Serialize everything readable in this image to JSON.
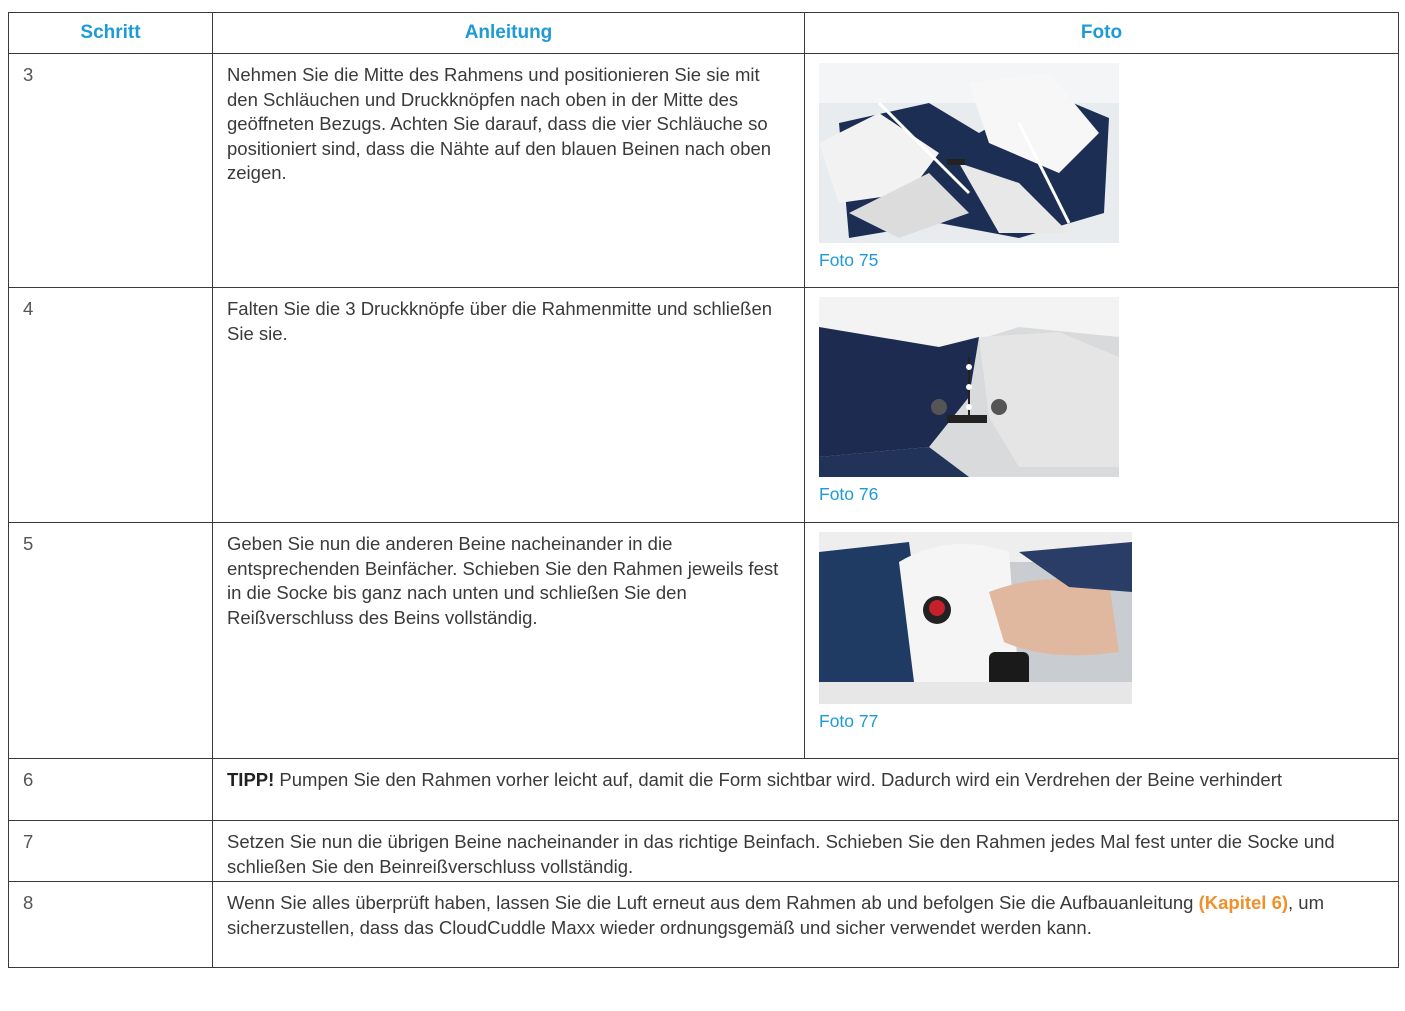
{
  "header": {
    "col1": "Schritt",
    "col2": "Anleitung",
    "col3": "Foto"
  },
  "rows": [
    {
      "step": "3",
      "text": "Nehmen Sie die Mitte des Rahmens und positionieren Sie sie mit den Schläuchen und Druckknöpfen nach oben in der Mitte des geöffneten Bezugs. Achten Sie darauf, dass die vier Schläuche so positioniert sind, dass die Nähte auf den blauen Beinen nach oben zeigen.",
      "caption": "Foto 75"
    },
    {
      "step": "4",
      "text": "Falten Sie die 3 Druckknöpfe über die Rahmenmitte und schließen Sie sie.",
      "caption": "Foto 76"
    },
    {
      "step": "5",
      "text": "Geben Sie nun die anderen Beine nacheinander in die entsprechenden Beinfächer. Schieben Sie den Rahmen jeweils fest in die Socke bis ganz nach unten und schließen Sie den Reißverschluss des Beins vollständig.",
      "caption": "Foto 77"
    },
    {
      "step": "6",
      "tip_label": "TIPP!",
      "text": " Pumpen Sie den Rahmen vorher leicht auf, damit die Form sichtbar wird. Dadurch wird ein Verdrehen der Beine verhindert"
    },
    {
      "step": "7",
      "text": "Setzen Sie nun die übrigen Beine nacheinander in das richtige Beinfach. Schieben Sie den Rahmen jedes Mal fest unter die Socke und schließen Sie den Beinreißverschluss vollständig."
    },
    {
      "step": "8",
      "text_before": "Wenn Sie alles überprüft haben, lassen Sie die Luft erneut aus dem Rahmen ab und befolgen Sie die Aufbauanleitung ",
      "link": "(Kapitel 6)",
      "text_after": ", um sicherzustellen, dass das CloudCuddle Maxx wieder ordnungsgemäß und sicher verwendet werden kann."
    }
  ],
  "colors": {
    "heading": "#1e9bd7",
    "link": "#f0902a",
    "border": "#3a3a3a"
  }
}
